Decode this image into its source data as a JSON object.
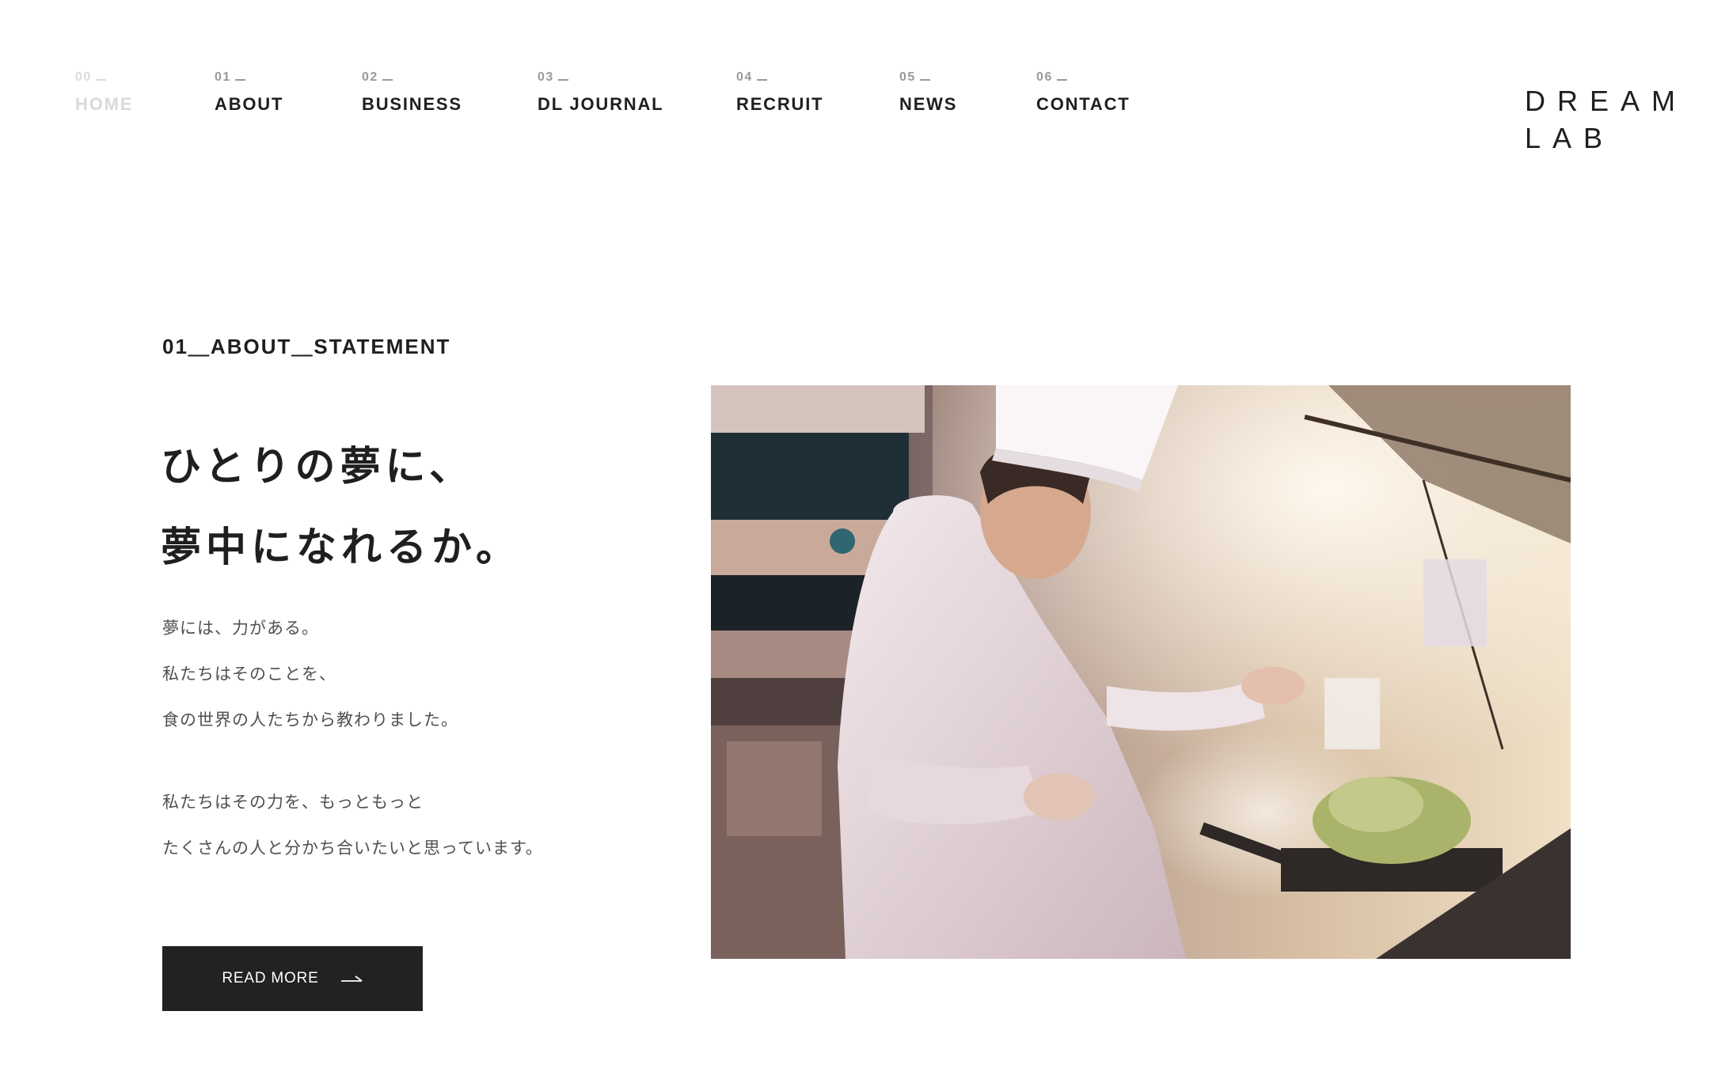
{
  "nav": {
    "items": [
      {
        "num": "00",
        "label": "HOME",
        "active": true
      },
      {
        "num": "01",
        "label": "ABOUT"
      },
      {
        "num": "02",
        "label": "BUSINESS"
      },
      {
        "num": "03",
        "label": "DL JOURNAL"
      },
      {
        "num": "04",
        "label": "RECRUIT"
      },
      {
        "num": "05",
        "label": "NEWS"
      },
      {
        "num": "06",
        "label": "CONTACT"
      }
    ]
  },
  "logo": {
    "line1": "DREAM",
    "line2": "LAB"
  },
  "about": {
    "section_label": "01＿ABOUT＿STATEMENT",
    "headline": [
      "ひとりの夢に、",
      "夢中になれるか。"
    ],
    "paragraphs": [
      "夢には、力がある。",
      "私たちはそのことを、",
      "食の世界の人たちから教わりました。",
      "私たちはその力を、もっともっと",
      "たくさんの人と分かち合いたいと思っています。"
    ],
    "read_more_label": "READ MORE",
    "arrow_icon": "long-arrow-right-icon"
  },
  "photo": {
    "subject": "chef-cooking-photo"
  },
  "colors": {
    "text": "#1f1f1f",
    "muted": "#9a9a9a",
    "inactive": "#d9d9d9",
    "button_bg": "#222222"
  }
}
